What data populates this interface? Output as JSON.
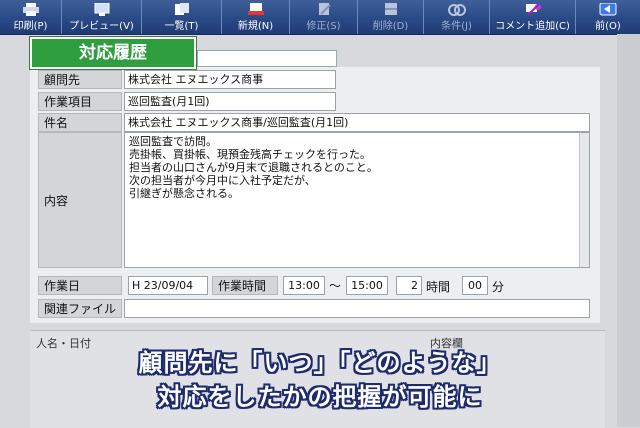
{
  "toolbar": {
    "buttons": [
      {
        "label": "印刷(P)",
        "icon": "printer-icon",
        "enabled": true
      },
      {
        "label": "プレビュー(V)",
        "icon": "monitor-icon",
        "enabled": true
      },
      {
        "label": "一覧(T)",
        "icon": "list-icon",
        "enabled": true
      },
      {
        "label": "新規(N)",
        "icon": "new-record-icon",
        "enabled": true
      },
      {
        "label": "修正(S)",
        "icon": "edit-icon",
        "enabled": false
      },
      {
        "label": "削除(D)",
        "icon": "delete-icon",
        "enabled": false
      },
      {
        "label": "条件(J)",
        "icon": "filter-icon",
        "enabled": false
      },
      {
        "label": "コメント追加(C)",
        "icon": "comment-icon",
        "enabled": true
      },
      {
        "label": "前(O)",
        "icon": "back-arrow-icon",
        "enabled": true
      }
    ]
  },
  "title": "対応履歴",
  "form": {
    "client_label": "顧問先",
    "client_value": "株式会社 エヌエックス商事",
    "work_item_label": "作業項目",
    "work_item_value": "巡回監査(月1回)",
    "subject_label": "件名",
    "subject_value": "株式会社 エヌエックス商事/巡回監査(月1回)",
    "content_label": "内容",
    "content_lines": [
      "巡回監査で訪問。",
      "売掛帳、買掛帳、現預金残高チェックを行った。",
      "担当者の山口さんが9月末で退職されるとのこと。",
      "次の担当者が今月中に入社予定だが、",
      "引継ぎが懸念される。"
    ],
    "work_date_label": "作業日",
    "work_date_value": "H 23/09/04",
    "work_time_label": "作業時間",
    "start_time": "13:00",
    "range_sep": "〜",
    "end_time": "15:00",
    "hours": "2",
    "hours_unit": "時間",
    "minutes": "00",
    "minutes_unit": "分",
    "related_file_label": "関連ファイル",
    "related_file_value": ""
  },
  "history": {
    "header_left": "人名・日付",
    "header_right": "内容欄"
  },
  "caption": {
    "line1": "顧問先に「いつ」「どのような」",
    "line2": "対応をしたかの把握が可能に"
  }
}
